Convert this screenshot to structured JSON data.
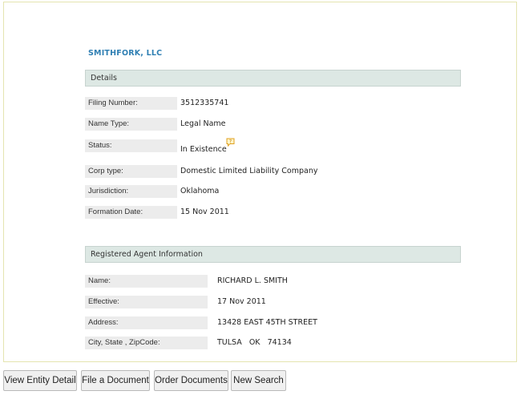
{
  "entity": {
    "name": "SMITHFORK, LLC"
  },
  "details": {
    "header": "Details",
    "rows": [
      {
        "label": "Filing Number:",
        "value": "3512335741"
      },
      {
        "label": "Name Type:",
        "value": "Legal Name"
      },
      {
        "label": "Status:",
        "value": "In Existence"
      },
      {
        "label": "Corp type:",
        "value": "Domestic Limited Liability Company"
      },
      {
        "label": "Jurisdiction:",
        "value": "Oklahoma"
      },
      {
        "label": "Formation Date:",
        "value": "15 Nov 2011"
      }
    ]
  },
  "agent": {
    "header": "Registered Agent Information",
    "rows": [
      {
        "label": "Name:",
        "value": "RICHARD L. SMITH"
      },
      {
        "label": "Effective:",
        "value": "17 Nov 2011"
      },
      {
        "label": "Address:",
        "value": "13428 EAST 45TH STREET"
      },
      {
        "label": "City, State , ZipCode:",
        "value": "TULSA   OK   74134"
      }
    ]
  },
  "buttons": {
    "view_entity_detail": "View Entity Detail",
    "file_document": "File a Document",
    "order_documents": "Order Documents",
    "new_search": "New Search"
  },
  "icons": {
    "status_note": "note-icon"
  },
  "colors": {
    "entity_name": "#2f7fb3",
    "section_header_bg": "#dde8e4",
    "label_bg": "#ececec",
    "note_icon": "#e0a020"
  }
}
